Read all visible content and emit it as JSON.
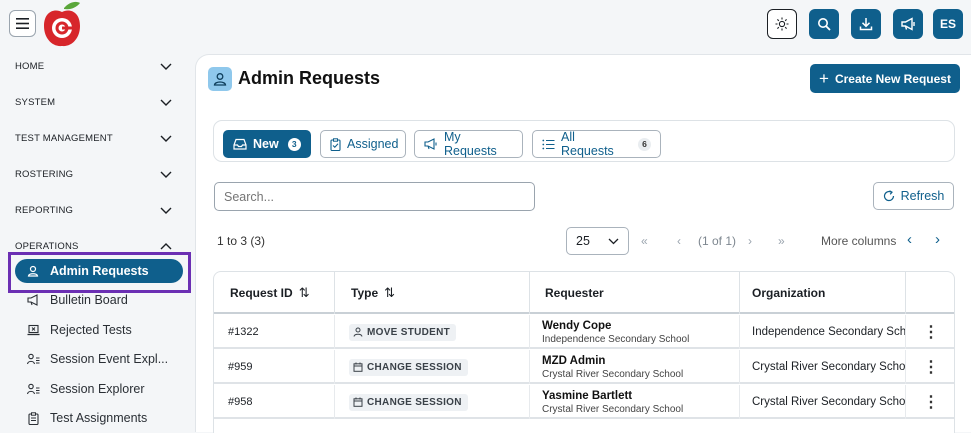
{
  "user": {
    "initials": "ES"
  },
  "sidebar": {
    "sections": [
      {
        "label": "HOME"
      },
      {
        "label": "SYSTEM"
      },
      {
        "label": "TEST MANAGEMENT"
      },
      {
        "label": "ROSTERING"
      },
      {
        "label": "REPORTING"
      },
      {
        "label": "OPERATIONS"
      }
    ],
    "items": [
      {
        "label": "Admin Requests",
        "icon": "person-badge-icon",
        "active": true
      },
      {
        "label": "Bulletin Board",
        "icon": "megaphone-icon"
      },
      {
        "label": "Rejected Tests",
        "icon": "laptop-x-icon"
      },
      {
        "label": "Session Event Expl...",
        "icon": "person-list-icon"
      },
      {
        "label": "Session Explorer",
        "icon": "person-list-icon"
      },
      {
        "label": "Test Assignments",
        "icon": "clipboard-icon"
      }
    ]
  },
  "page": {
    "title": "Admin Requests",
    "create_label": "Create New Request"
  },
  "tabs": [
    {
      "label": "New",
      "count": "3",
      "active": true
    },
    {
      "label": "Assigned"
    },
    {
      "label": "My Requests"
    },
    {
      "label": "All Requests",
      "count": "6"
    }
  ],
  "search": {
    "placeholder": "Search..."
  },
  "refresh_label": "Refresh",
  "pagination": {
    "range": "1 to 3 (3)",
    "page_size": "25",
    "page_info": "(1 of 1)",
    "more_columns": "More columns"
  },
  "table": {
    "columns": [
      "Request ID",
      "Type",
      "Requester",
      "Organization"
    ],
    "rows": [
      {
        "id": "#1322",
        "type": "MOVE STUDENT",
        "type_icon": "person-move-icon",
        "requester": "Wendy Cope",
        "requester_org": "Independence Secondary School",
        "organization": "Independence Secondary School"
      },
      {
        "id": "#959",
        "type": "CHANGE SESSION",
        "type_icon": "calendar-icon",
        "requester": "MZD Admin",
        "requester_org": "Crystal River Secondary School",
        "organization": "Crystal River Secondary School"
      },
      {
        "id": "#958",
        "type": "CHANGE SESSION",
        "type_icon": "calendar-icon",
        "requester": "Yasmine Bartlett",
        "requester_org": "Crystal River Secondary School",
        "organization": "Crystal River Secondary School"
      }
    ]
  },
  "colors": {
    "primary": "#0f5f8c",
    "highlight": "#6b2fb3",
    "logo_red": "#d7262b"
  }
}
